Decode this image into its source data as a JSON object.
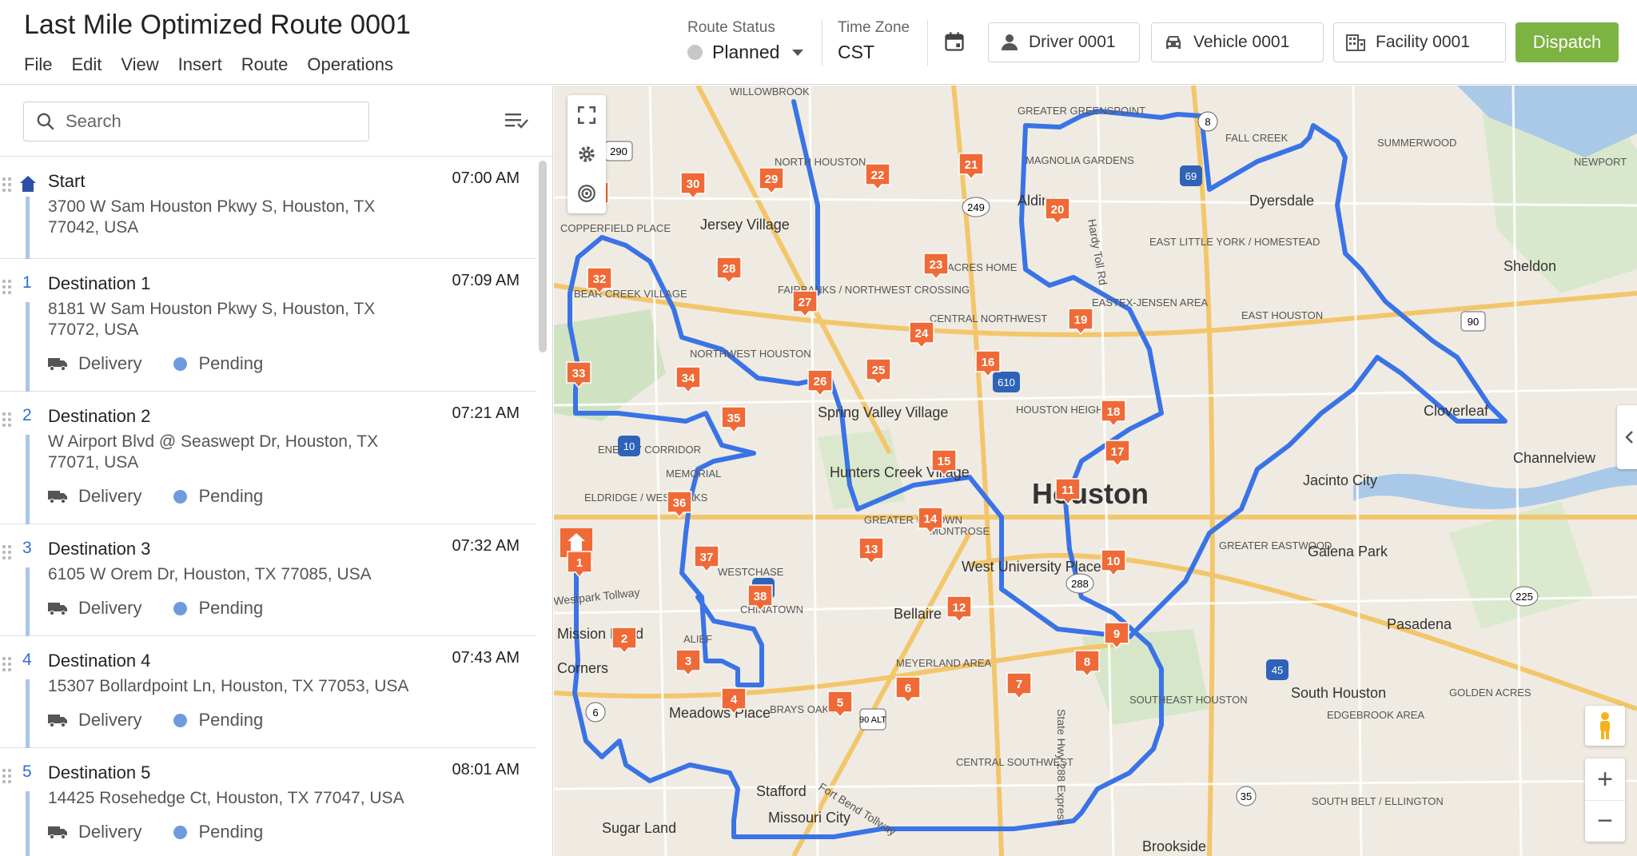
{
  "header": {
    "title": "Last Mile Optimized Route 0001",
    "menu": [
      "File",
      "Edit",
      "View",
      "Insert",
      "Route",
      "Operations"
    ],
    "route_status_label": "Route Status",
    "route_status_value": "Planned",
    "timezone_label": "Time Zone",
    "timezone_value": "CST",
    "driver": "Driver 0001",
    "vehicle": "Vehicle 0001",
    "facility": "Facility 0001",
    "dispatch": "Dispatch"
  },
  "sidebar": {
    "search_placeholder": "Search",
    "start": {
      "name": "Start",
      "time": "07:00 AM",
      "address": "3700 W Sam Houston Pkwy S, Houston, TX 77042, USA"
    },
    "stops": [
      {
        "num": "1",
        "name": "Destination 1",
        "time": "07:09 AM",
        "address": "8181 W Sam Houston Pkwy S, Houston, TX 77072, USA",
        "type": "Delivery",
        "status": "Pending"
      },
      {
        "num": "2",
        "name": "Destination 2",
        "time": "07:21 AM",
        "address": "W Airport Blvd @ Seaswept Dr, Houston, TX 77071, USA",
        "type": "Delivery",
        "status": "Pending"
      },
      {
        "num": "3",
        "name": "Destination 3",
        "time": "07:32 AM",
        "address": "6105 W Orem Dr, Houston, TX 77085, USA",
        "type": "Delivery",
        "status": "Pending"
      },
      {
        "num": "4",
        "name": "Destination 4",
        "time": "07:43 AM",
        "address": "15307 Bollardpoint Ln, Houston, TX 77053, USA",
        "type": "Delivery",
        "status": "Pending"
      },
      {
        "num": "5",
        "name": "Destination 5",
        "time": "08:01 AM",
        "address": "14425 Rosehedge Ct, Houston, TX 77047, USA",
        "type": "Delivery",
        "status": "Pending"
      }
    ]
  },
  "map": {
    "city_label": "Houston",
    "place_labels": [
      "WILLOWBROOK",
      "GREATER GREENSPOINT",
      "NORTH HOUSTON",
      "MAGNOLIA GARDENS",
      "FALL CREEK",
      "SUMMERWOOD",
      "NEWPORT",
      "Aldine",
      "Dyersdale",
      "Jersey Village",
      "COPPERFIELD PLACE",
      "EAST LITTLE YORK / HOMESTEAD",
      "Sheldon",
      "ACRES HOME",
      "FAIRBANKS / NORTHWEST CROSSING",
      "BEAR CREEK VILLAGE",
      "EASTEX-JENSEN AREA",
      "CENTRAL NORTHWEST",
      "EAST HOUSTON",
      "NORTHWEST HOUSTON",
      "HOUSTON HEIGHTS",
      "Spring Valley Village",
      "Cloverleaf",
      "ENERGY CORRIDOR",
      "MEMORIAL",
      "Channelview",
      "Hunters Creek Village",
      "Jacinto City",
      "ELDRIDGE / WEST OAKS",
      "GREATER UPTOWN",
      "MONTROSE",
      "GREATER EASTWOOD",
      "Galena Park",
      "WESTCHASE",
      "West University Place",
      "CHINATOWN",
      "Bellaire",
      "Pasadena",
      "Mission Bend",
      "ALIEF",
      "MEYERLAND AREA",
      "Corners",
      "SOUTHEAST HOUSTON",
      "South Houston",
      "GOLDEN ACRES",
      "Meadows Place",
      "BRAYS OAKS",
      "EDGEBROOK AREA",
      "Stafford",
      "CENTRAL SOUTHWEST",
      "Missouri City",
      "SOUTH BELT / ELLINGTON",
      "Sugar Land",
      "Brookside",
      "Hardy Toll Rd",
      "State Hwy 288 Express",
      "Westpark Tollway",
      "Fort Bend Tollway"
    ],
    "route_markers": [
      "1",
      "2",
      "3",
      "4",
      "5",
      "6",
      "7",
      "8",
      "9",
      "10",
      "11",
      "12",
      "13",
      "14",
      "15",
      "16",
      "17",
      "18",
      "19",
      "20",
      "21",
      "22",
      "23",
      "24",
      "25",
      "26",
      "27",
      "28",
      "29",
      "30",
      "31",
      "32",
      "33",
      "34",
      "35",
      "36",
      "37",
      "38"
    ],
    "shields": [
      "290",
      "249",
      "8",
      "69",
      "610",
      "10",
      "45",
      "225",
      "90",
      "288",
      "59",
      "6",
      "35",
      "90 ALT"
    ]
  },
  "colors": {
    "accent": "#7cb342",
    "route": "#3a73e6",
    "marker": "#ef6a37",
    "link": "#2e6fd1"
  },
  "icons": [
    "search-icon",
    "sort-icon",
    "calendar-icon",
    "person-icon",
    "car-icon",
    "building-icon",
    "home-icon",
    "truck-icon",
    "fullscreen-icon",
    "gear-icon",
    "layers-icon",
    "pegman-icon",
    "zoom-in-icon",
    "zoom-out-icon",
    "chevron-left-icon"
  ]
}
